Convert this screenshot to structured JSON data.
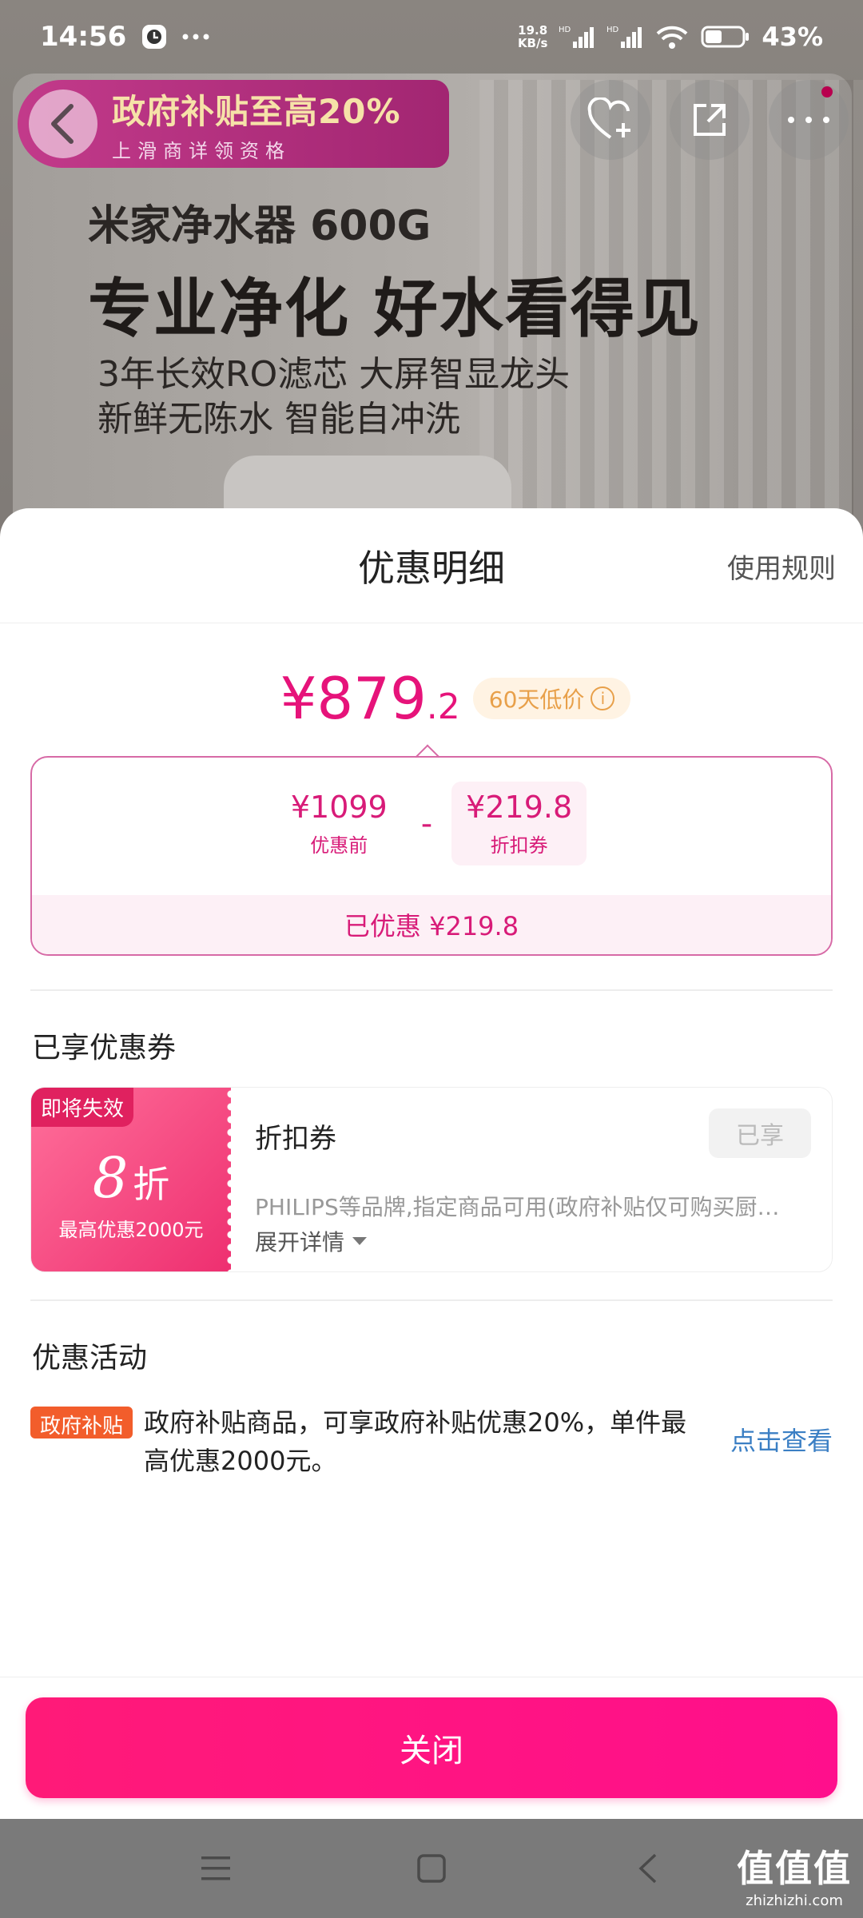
{
  "status_bar": {
    "time": "14:56",
    "net_speed_value": "19.8",
    "net_speed_unit": "KB/s",
    "battery": "43%",
    "icons": [
      "app-icon",
      "more-dots-icon",
      "signal-icon",
      "wifi-icon",
      "battery-icon"
    ]
  },
  "background_page": {
    "promo_title": "政府补贴至高20%",
    "promo_subtitle": "上滑商详领资格",
    "hero_product": "米家净水器 600G",
    "hero_slogan": "专业净化 好水看得见",
    "hero_line1": "3年长效RO滤芯  大屏智显龙头",
    "hero_line2": "新鲜无陈水 智能自冲洗",
    "icons": [
      "back-icon",
      "favorite-add-icon",
      "share-icon",
      "more-icon"
    ]
  },
  "sheet": {
    "title": "优惠明细",
    "rules_link": "使用规则",
    "final_price_main": "¥879",
    "final_price_decimal": ".2",
    "low_price_badge": "60天低价",
    "calc": {
      "original_value": "¥1099",
      "original_caption": "优惠前",
      "minus": "-",
      "coupon_value": "¥219.8",
      "coupon_caption": "折扣券",
      "saved_text": "已优惠 ¥219.8"
    },
    "coupons_section_title": "已享优惠券",
    "coupon": {
      "expire_tag": "即将失效",
      "discount_number": "8",
      "discount_unit": "折",
      "max_off": "最高优惠2000元",
      "name": "折扣券",
      "status_button": "已享",
      "description": "PHILIPS等品牌,指定商品可用(政府补贴仅可购买厨…",
      "expand_label": "展开详情"
    },
    "activities_section_title": "优惠活动",
    "activity": {
      "tag": "政府补贴",
      "text": "政府补贴商品，可享政府补贴优惠20%，单件最高优惠2000元。",
      "link": "点击查看"
    },
    "close_button": "关闭"
  },
  "nav_bar": {
    "icons": [
      "menu-icon",
      "home-square-icon",
      "back-arrow-icon"
    ]
  },
  "watermark": {
    "big": "值值值",
    "small": "zhizhizhi.com"
  },
  "colors": {
    "accent": "#e6137a",
    "close_button": "#ff1a78",
    "link": "#3b7fc4",
    "tag_orange": "#f25d2b"
  }
}
